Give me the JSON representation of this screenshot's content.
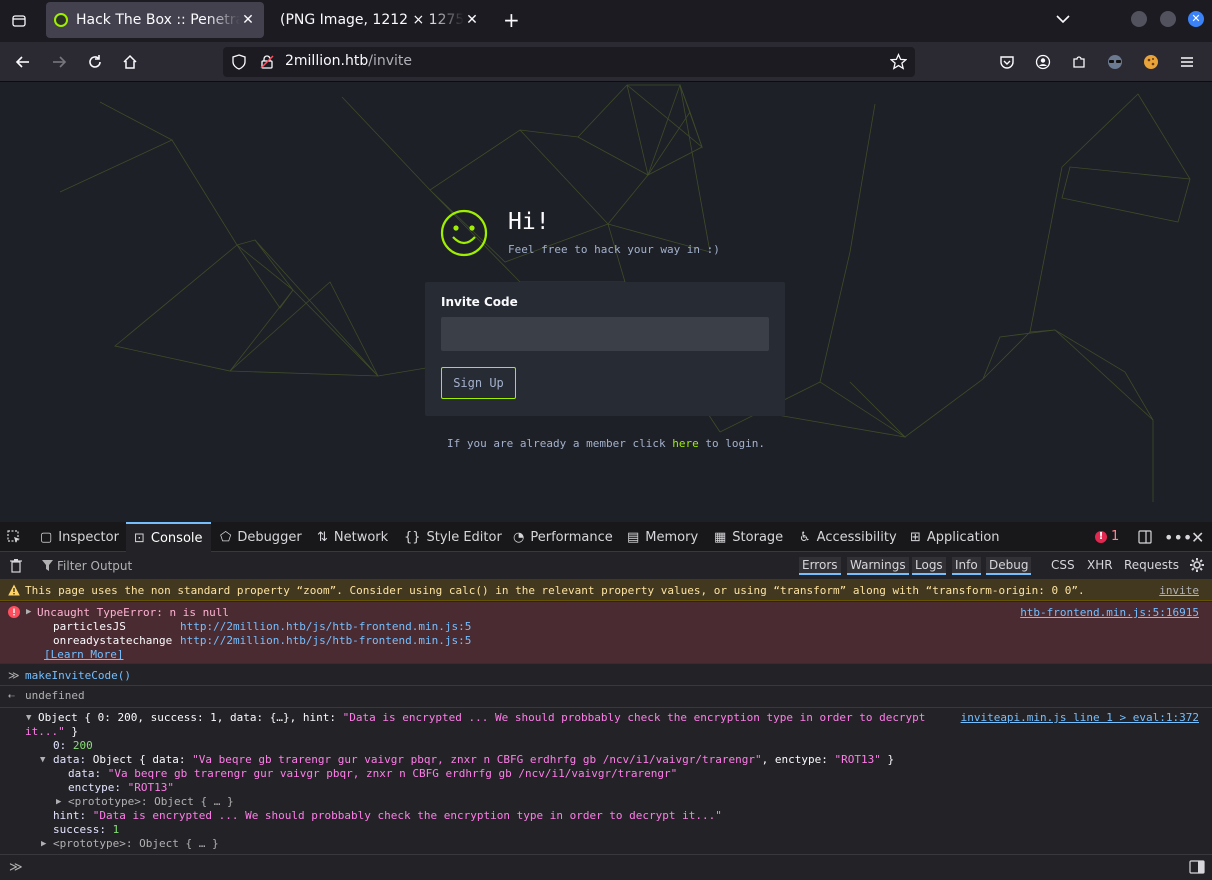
{
  "browser": {
    "tabs": [
      {
        "title": "Hack The Box :: Penetration Testing Labs",
        "active": true
      },
      {
        "title": "(PNG Image, 1212 × 1275 pixels)",
        "active": false
      }
    ],
    "url_host": "2million.htb",
    "url_path": "/invite"
  },
  "page": {
    "greeting": "Hi!",
    "tagline": "Feel free to hack your way in :)",
    "invite_label": "Invite Code",
    "invite_value": "",
    "signup_label": "Sign Up",
    "login_prefix": "If you are already a member click",
    "login_link": "here",
    "login_suffix": "to login.",
    "accent": "#9fef00"
  },
  "devtools": {
    "tabs": [
      "Inspector",
      "Console",
      "Debugger",
      "Network",
      "Style Editor",
      "Performance",
      "Memory",
      "Storage",
      "Accessibility",
      "Application"
    ],
    "selected_tab": "Console",
    "error_count": "1",
    "filter_placeholder": "Filter Output",
    "filters": [
      "Errors",
      "Warnings",
      "Logs",
      "Info",
      "Debug"
    ],
    "extra_filters": [
      "CSS",
      "XHR",
      "Requests"
    ],
    "warning": {
      "text": "This page uses the non standard property “zoom”. Consider using calc() in the relevant property values, or using “transform” along with “transform-origin: 0 0”.",
      "source": "invite"
    },
    "error": {
      "text": "Uncaught TypeError: n is null",
      "source": "htb-frontend.min.js:5:16915",
      "stack": [
        {
          "fn": "particlesJS",
          "url": "http://2million.htb/js/htb-frontend.min.js:5"
        },
        {
          "fn": "onreadystatechange",
          "url": "http://2million.htb/js/htb-frontend.min.js:5"
        }
      ],
      "learn_more": "[Learn More]"
    },
    "input_cmd": "makeInviteCode()",
    "undefined": "undefined",
    "result": {
      "summary_start": "Object { 0: 200, success: 1, data: {…}, hint: ",
      "summary_hint": "\"Data is encrypted ... We should probbably check the encryption type in order to decrypt",
      "summary_hint_cont": "it...\"",
      "summary_end": " }",
      "source": "inviteapi.min.js line 1 > eval:1:372",
      "zero_key": "0:",
      "zero_val": "200",
      "data_key": "data:",
      "data_summary_start": "Object { data: ",
      "data_summary_str": "\"Va beqre gb trarengr gur vaivgr pbqr, znxr n CBFG erdhrfg gb /ncv/i1/vaivgr/trarengr\"",
      "data_summary_mid": ", enctype: ",
      "data_summary_enc": "\"ROT13\"",
      "data_summary_end": " }",
      "data_data_key": "data:",
      "data_data_val": "\"Va beqre gb trarengr gur vaivgr pbqr, znxr n CBFG erdhrfg gb /ncv/i1/vaivgr/trarengr\"",
      "enctype_key": "enctype:",
      "enctype_val": "\"ROT13\"",
      "prototype_key": "<prototype>:",
      "prototype_val": "Object { … }",
      "hint_key": "hint:",
      "hint_val": "\"Data is encrypted ... We should probbably check the encryption type in order to decrypt it...\"",
      "success_key": "success:",
      "success_val": "1"
    }
  }
}
